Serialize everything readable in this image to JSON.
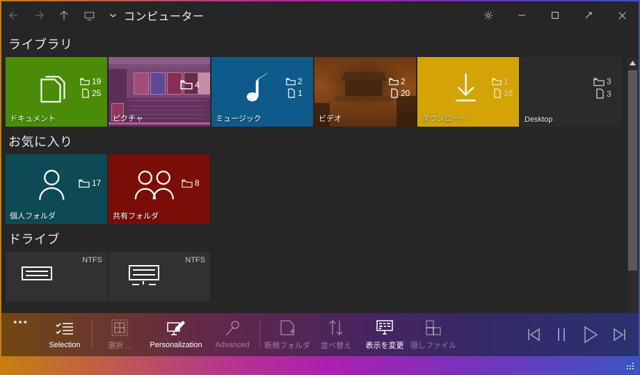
{
  "titlebar": {
    "back_icon": "back-arrow-icon",
    "forward_icon": "forward-arrow-icon",
    "up_icon": "up-arrow-icon",
    "computer_icon": "monitor-icon",
    "dropdown_icon": "chevron-down-icon",
    "address": "コンピューター",
    "settings_icon": "gear-icon",
    "minimize_icon": "minimize-icon",
    "maximize_icon": "maximize-icon",
    "restore_icon": "diagonal-arrow-icon",
    "close_icon": "close-icon"
  },
  "sections": [
    {
      "id": "library",
      "title": "ライブラリ"
    },
    {
      "id": "favorites",
      "title": "お気に入り"
    },
    {
      "id": "drives",
      "title": "ドライブ"
    }
  ],
  "library_tiles": [
    {
      "label": "ドキュメント",
      "color": "#4a8c07",
      "icon": "documents-icon",
      "folders": "19",
      "files": "25"
    },
    {
      "label": "ピクチャ",
      "color": "#6d3a63",
      "icon": "picture-thumbnail",
      "folders": "4",
      "files": ""
    },
    {
      "label": "ミュージック",
      "color": "#0e5a8a",
      "icon": "music-note-icon",
      "folders": "2",
      "files": "1"
    },
    {
      "label": "ビデオ",
      "color": "#8d4d19",
      "icon": "video-thumbnail",
      "folders": "2",
      "files": "20"
    },
    {
      "label": "ダウンロード",
      "color": "#d4a406",
      "icon": "download-arrow-icon",
      "folders": "1",
      "files": "16"
    },
    {
      "label": "Desktop",
      "color": "#2b2b2b",
      "icon": "desktop-icon",
      "folders": "3",
      "files": "3"
    }
  ],
  "favorite_tiles": [
    {
      "label": "個人フォルダ",
      "color": "#0d4a55",
      "icon": "person-icon",
      "folders": "17"
    },
    {
      "label": "共有フォルダ",
      "color": "#7a0d06",
      "icon": "people-icon",
      "folders": "8"
    }
  ],
  "drive_tiles": [
    {
      "filesystem": "NTFS",
      "icon": "hard-drive-icon"
    },
    {
      "filesystem": "NTFS",
      "icon": "system-drive-icon"
    }
  ],
  "toolbar": {
    "overflow_label": "•••",
    "items": [
      {
        "label": "Selection",
        "icon": "checklist-icon",
        "enabled": true
      },
      {
        "label": "選択 ...",
        "icon": "select-grid-icon",
        "enabled": false
      },
      {
        "label": "Personalization",
        "icon": "paintbrush-monitor-icon",
        "enabled": true
      },
      {
        "label": "Advanced",
        "icon": "wrench-icon",
        "enabled": false
      },
      {
        "label": "新規フォルダ",
        "icon": "new-folder-icon",
        "enabled": false
      },
      {
        "label": "並べ替え",
        "icon": "sort-arrows-icon",
        "enabled": false
      },
      {
        "label": "表示を変更",
        "icon": "change-view-icon",
        "enabled": true
      },
      {
        "label": "隠しファイル",
        "icon": "hidden-files-icon",
        "enabled": false
      }
    ],
    "media": [
      {
        "name": "previous-track-button",
        "icon": "skip-back-icon"
      },
      {
        "name": "pause-button",
        "icon": "pause-icon"
      },
      {
        "name": "play-button",
        "icon": "play-icon"
      },
      {
        "name": "next-track-button",
        "icon": "skip-forward-icon"
      }
    ]
  },
  "scrollbar": {
    "up_icon": "scroll-up-arrow-icon",
    "down_icon": "scroll-down-arrow-icon"
  },
  "colors": {
    "accent_start": "#c87f10",
    "accent_mid": "#ab1fb1",
    "accent_end": "#3b54c2",
    "window_bg": "#262626"
  }
}
